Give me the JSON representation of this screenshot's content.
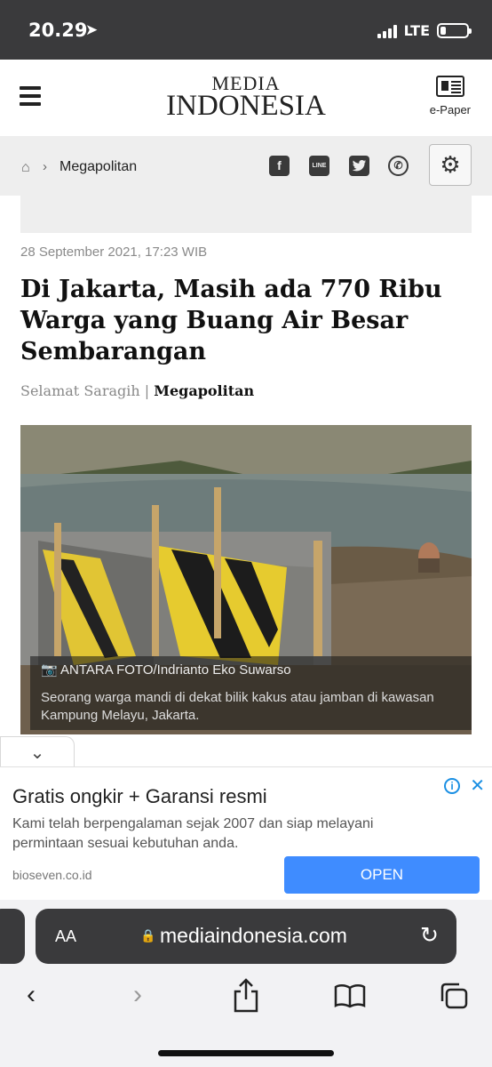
{
  "status_bar": {
    "time": "20.29",
    "network": "LTE"
  },
  "header": {
    "logo_line1": "MEDIA",
    "logo_line2": "INDONESIA",
    "epaper_label": "e-Paper"
  },
  "breadcrumb": {
    "section": "Megapolitan"
  },
  "social": {
    "facebook": "f",
    "line": "LINE"
  },
  "article": {
    "date": "28 September 2021, 17:23 WIB",
    "title": "Di Jakarta, Masih ada 770 Ribu Warga yang Buang Air Besar Sembarangan",
    "author": "Selamat Saragih",
    "separator": "|",
    "category": "Megapolitan",
    "photo_credit": "ANTARA FOTO/Indrianto Eko Suwarso",
    "photo_caption": "Seorang warga mandi di dekat bilik kakus atau jamban di kawasan Kampung Melayu, Jakarta."
  },
  "ad": {
    "title": "Gratis ongkir + Garansi resmi",
    "description": "Kami telah berpengalaman sejak 2007 dan siap melayani permintaan sesuai kebutuhan anda.",
    "domain": "bioseven.co.id",
    "cta": "OPEN"
  },
  "browser": {
    "text_size_label": "AA",
    "url": "mediaindonesia.com"
  },
  "colors": {
    "status_bar_bg": "#3a3a3c",
    "ad_button": "#3f8cff",
    "breadcrumb_bg": "#eeeeee"
  }
}
